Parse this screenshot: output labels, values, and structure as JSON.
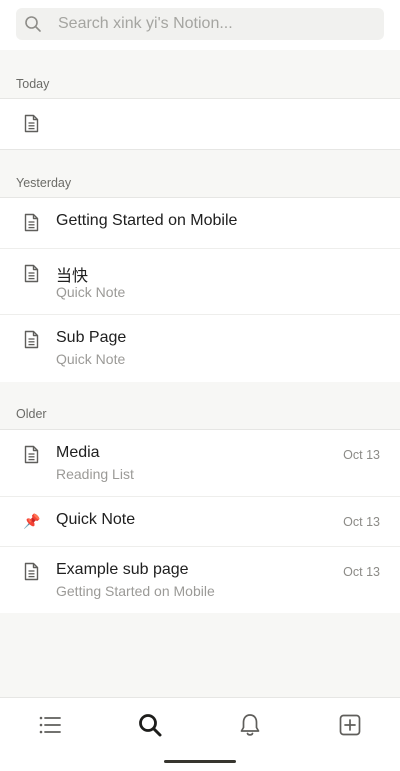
{
  "search": {
    "placeholder": "Search xink yi's Notion..."
  },
  "sections": {
    "today": {
      "label": "Today"
    },
    "yesterday": {
      "label": "Yesterday"
    },
    "older": {
      "label": "Older"
    }
  },
  "today_items": [
    {
      "title": "",
      "icon": "page-icon"
    }
  ],
  "yesterday_items": [
    {
      "title": "Getting Started on Mobile",
      "icon": "page-icon"
    },
    {
      "title": "当快",
      "subtitle": "Quick Note",
      "icon": "page-icon"
    },
    {
      "title": "Sub Page",
      "subtitle": "Quick Note",
      "icon": "page-icon"
    }
  ],
  "older_items": [
    {
      "title": "Media",
      "subtitle": "Reading List",
      "date": "Oct 13",
      "icon": "page-icon"
    },
    {
      "title": "Quick Note",
      "date": "Oct 13",
      "icon": "pushpin-icon",
      "pin_glyph": "📌"
    },
    {
      "title": "Example sub page",
      "subtitle": "Getting Started on Mobile",
      "date": "Oct 13",
      "icon": "page-icon"
    }
  ],
  "bottom_nav": {
    "items": [
      "list-icon",
      "search-icon",
      "bell-icon",
      "add-page-icon"
    ],
    "active": "search-icon"
  },
  "colors": {
    "background": "#f7f7f5",
    "text": "#37352f",
    "muted": "#9b9a97"
  }
}
